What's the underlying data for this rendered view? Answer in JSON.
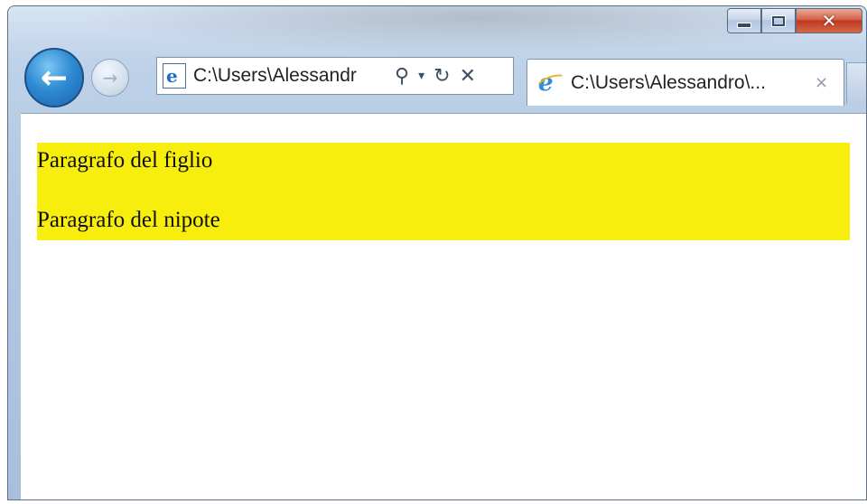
{
  "browser": {
    "address_text": "C:\\Users\\Alessandr",
    "tab_title": "C:\\Users\\Alessandro\\...",
    "tab_close": "×",
    "icons": {
      "back": "back-arrow-icon",
      "forward": "forward-arrow-icon",
      "page": "ie-page-icon",
      "search": "search-icon",
      "dropdown": "dropdown-arrow-icon",
      "refresh": "refresh-icon",
      "stop": "stop-icon",
      "tab": "ie-logo-icon"
    },
    "caption_buttons": {
      "minimize": "minimize-icon",
      "maximize": "maximize-icon",
      "close": "close-icon"
    }
  },
  "page": {
    "paragraph_1": "Paragrafo del figlio",
    "paragraph_2": "Paragrafo del nipote",
    "highlight_color": "#f7ee0e"
  }
}
